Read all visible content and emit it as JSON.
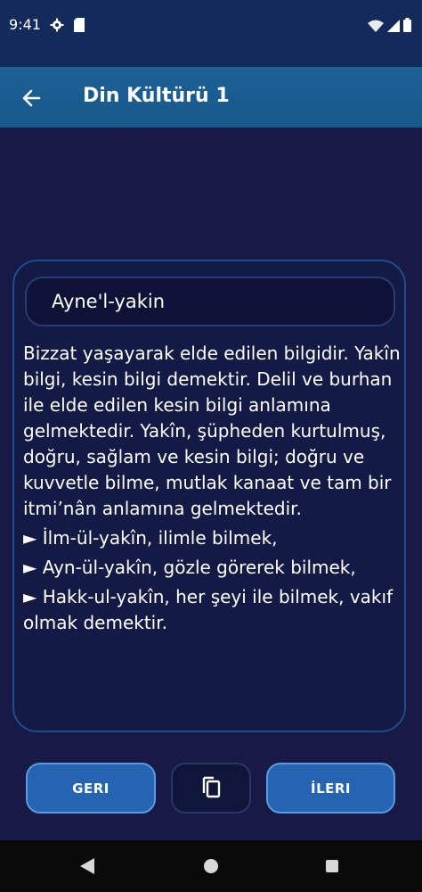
{
  "status_bar": {
    "time": "9:41",
    "icons_left": [
      "gear-icon",
      "sd-card-icon"
    ],
    "icons_right": [
      "wifi-icon",
      "signal-icon",
      "battery-icon"
    ]
  },
  "app_bar": {
    "title": "Din Kültürü 1",
    "back_icon": "arrow-left-icon"
  },
  "card": {
    "term": "Ayne'l-yakin",
    "definition": "Bizzat yaşayarak elde edilen bilgidir. Yakîn bilgi, kesin bilgi demektir. Delil ve burhan ile elde edilen kesin bilgi anlamına gelmektedir. Yakîn, şüpheden kurtulmuş, doğru, sağlam ve kesin bilgi; doğru ve kuvvetle bilme, mutlak kanaat ve tam bir itmi’nân anlamına gelmektedir.",
    "bullets": [
      "► İlm-ül-yakîn, ilimle bilmek,",
      "► Ayn-ül-yakîn, gözle görerek bilmek,",
      "► Hakk-ul-yakîn, her şeyi ile bilmek, vakıf olmak demektir."
    ]
  },
  "actions": {
    "prev_label": "GERI",
    "next_label": "İLERI",
    "copy_icon": "copy-icon"
  },
  "colors": {
    "background": "#161a45",
    "app_bar": "#1d6197",
    "button": "#2564b1",
    "button_border": "#5b99e3"
  }
}
